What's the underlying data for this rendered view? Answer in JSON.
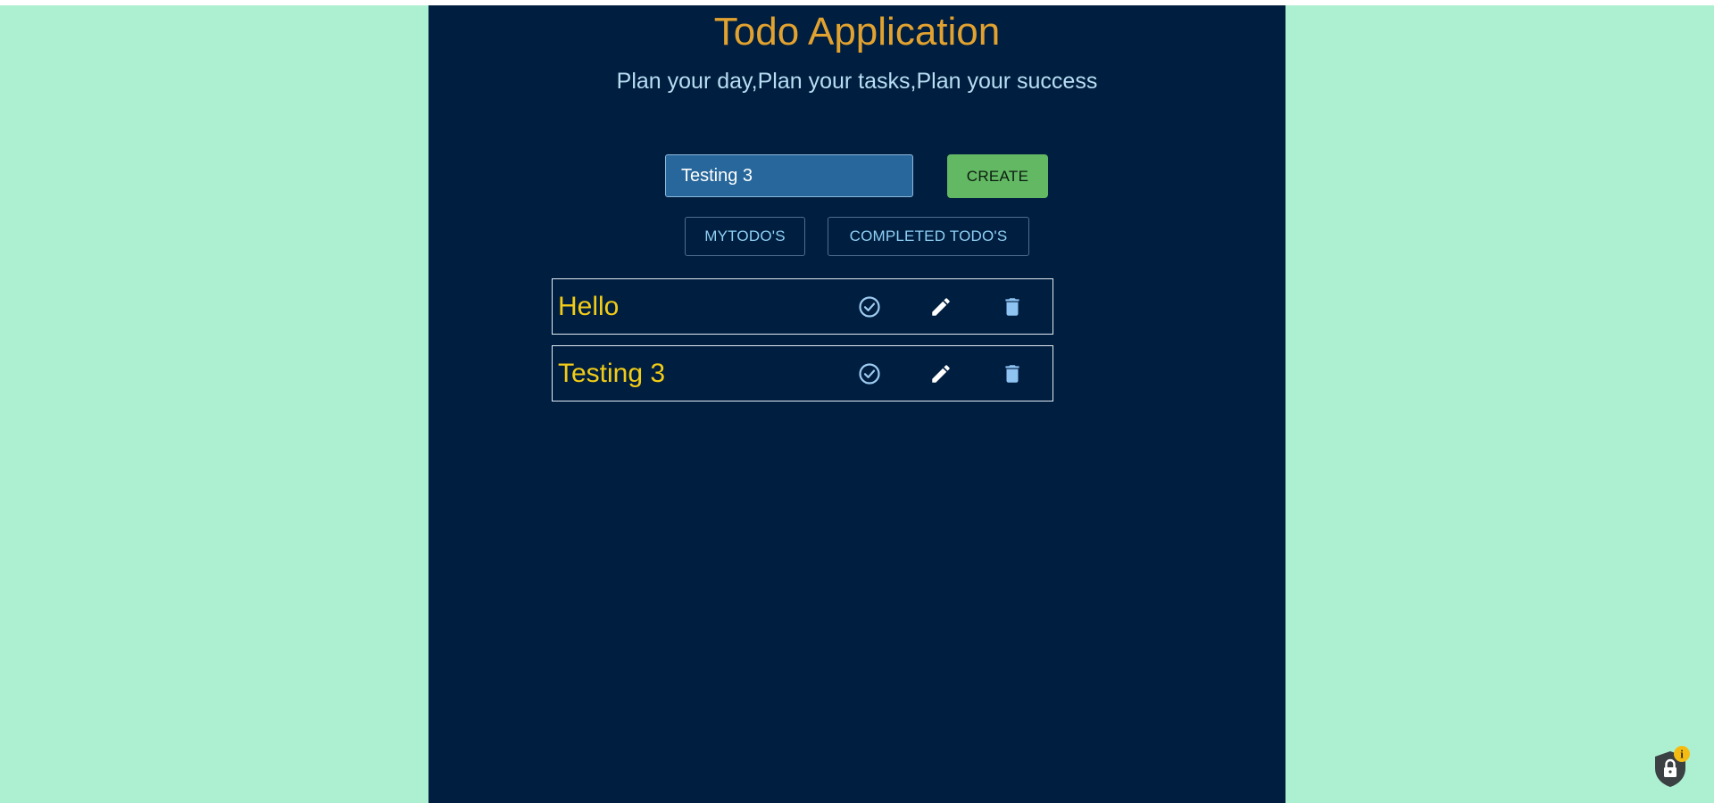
{
  "app": {
    "title": "Todo Application",
    "subtitle": "Plan your day,Plan your tasks,Plan your success"
  },
  "form": {
    "input_value": "Testing 3",
    "create_label": "CREATE"
  },
  "tabs": [
    {
      "label": "MYTODO'S"
    },
    {
      "label": "COMPLETED TODO'S"
    }
  ],
  "todos": [
    {
      "text": "Hello"
    },
    {
      "text": "Testing 3"
    }
  ],
  "icons": {
    "complete": "check-circle-icon",
    "edit": "pencil-icon",
    "delete": "trash-icon",
    "badge": "shield-lock-icon",
    "badge_info": "i"
  },
  "colors": {
    "page_background": "#adf0d1",
    "panel_background": "#001e3f",
    "title": "#e2a230",
    "subtitle": "#b9def4",
    "input_background": "#27679b",
    "create_button": "#63b863",
    "tab_text": "#8fd0f5",
    "todo_text": "#f2cc17",
    "check_icon": "#9ecbf2",
    "edit_icon": "#ffffff",
    "trash_icon": "#8ec3f2"
  }
}
